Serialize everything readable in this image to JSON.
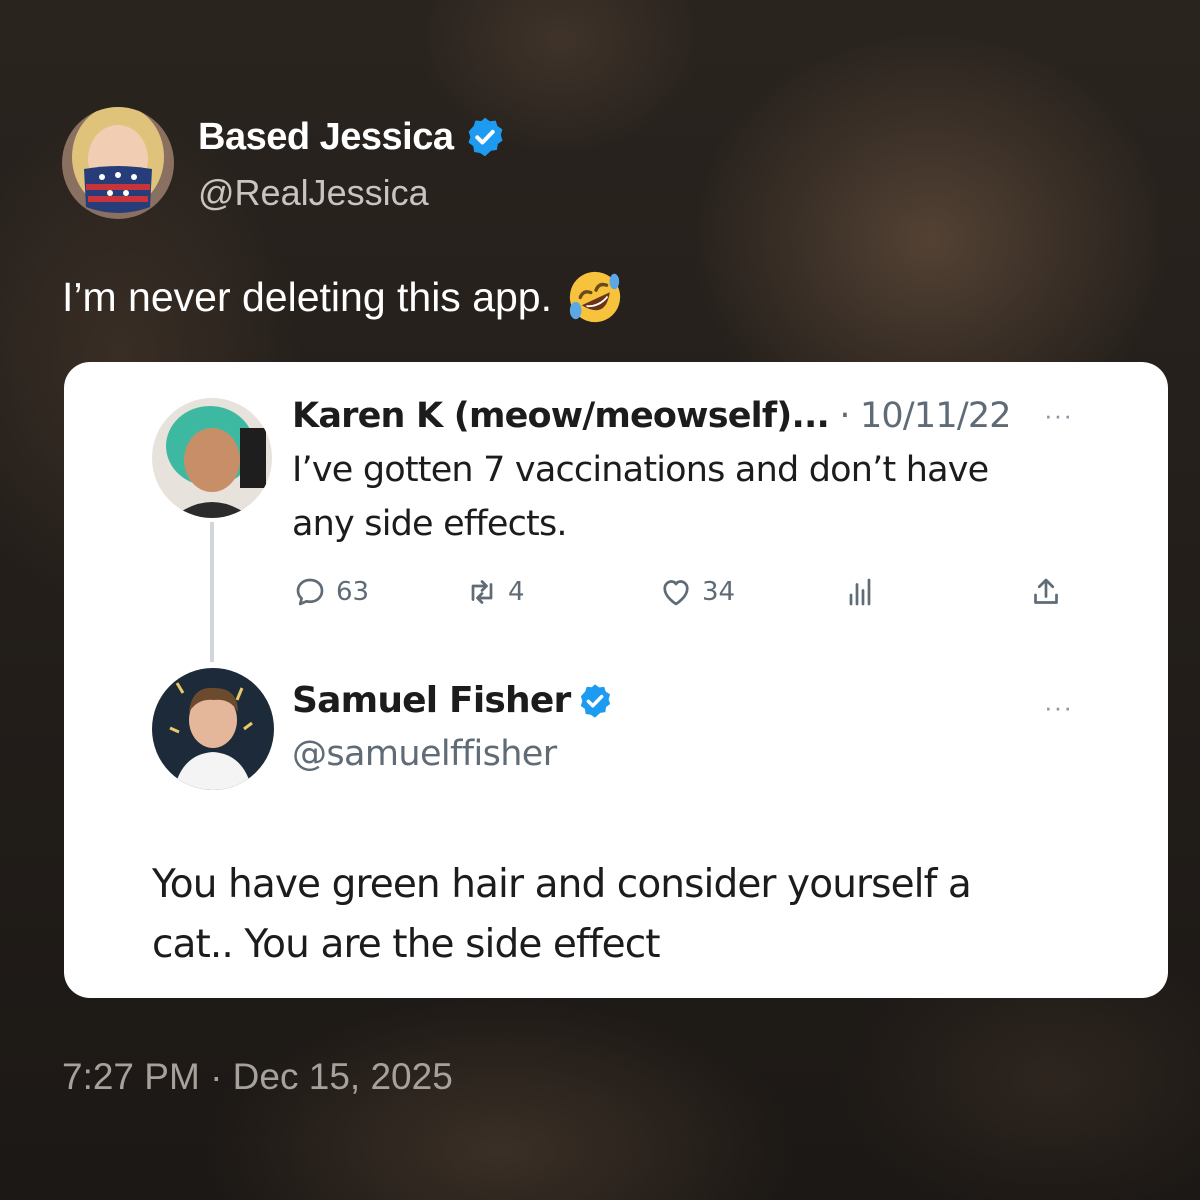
{
  "outer_tweet": {
    "display_name": "Based Jessica",
    "handle": "@RealJessica",
    "text": "I’m never deleting this app.",
    "emoji": "rolling-on-floor-laughing-icon",
    "timestamp": "7:27 PM · Dec 15, 2025"
  },
  "quoted_image": {
    "original_tweet": {
      "display_name": "Karen K (meow/meowself)...",
      "date": "· 10/11/22",
      "more_icon": "···",
      "text_line1": "I’ve gotten 7 vaccinations and don’t have",
      "text_line2": "any side effects.",
      "actions": {
        "replies": "63",
        "retweets": "4",
        "likes": "34"
      }
    },
    "reply": {
      "display_name": "Samuel Fisher",
      "handle": "@samuelffisher",
      "more_icon": "···",
      "text_line1": "You have green hair and consider yourself a",
      "text_line2": "cat.. You are the side effect"
    }
  },
  "colors": {
    "verified": "#1d9bf0",
    "card_background": "#ffffff",
    "page_background": "#231e1a"
  }
}
